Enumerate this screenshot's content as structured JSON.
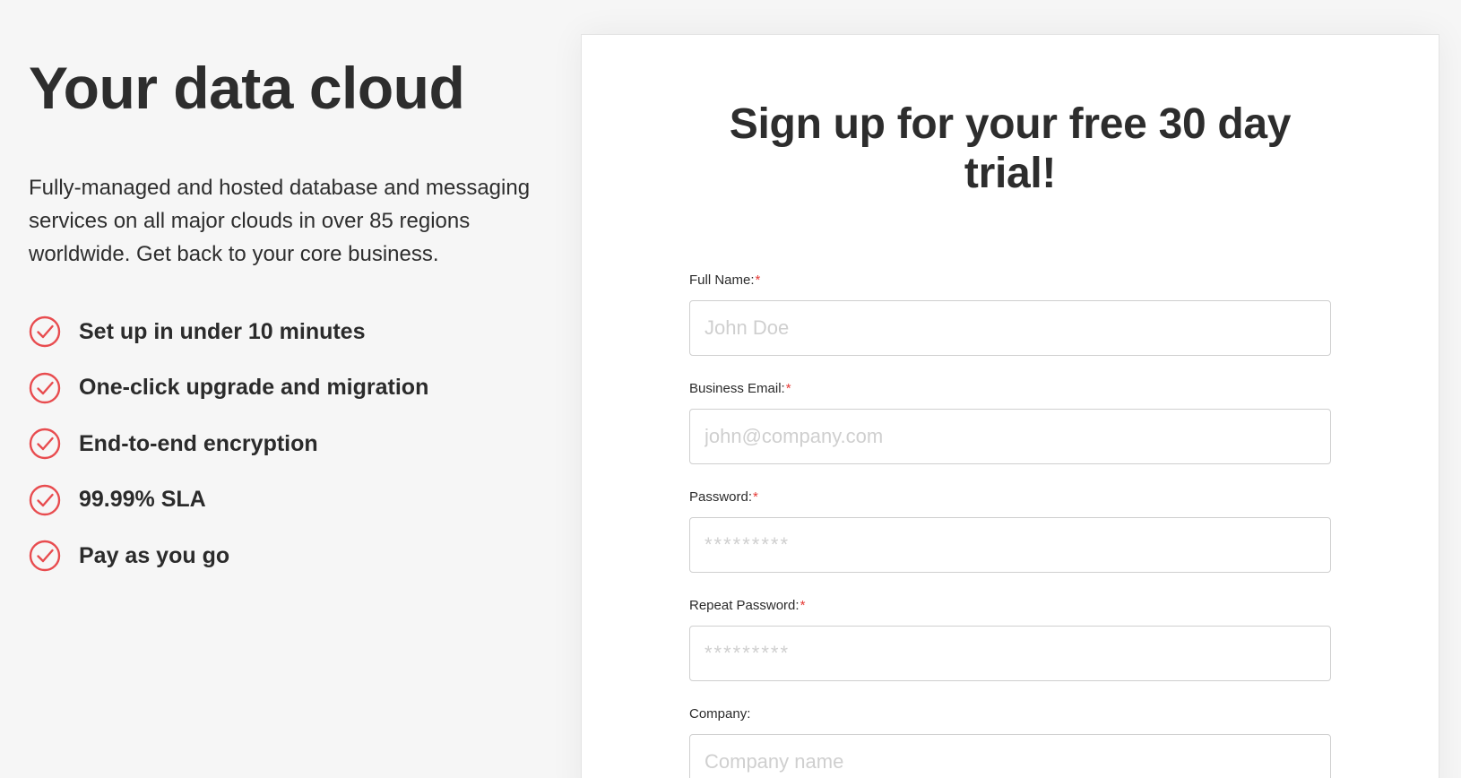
{
  "hero": {
    "title": "Your data cloud",
    "description": "Fully-managed and hosted database and messaging services on all major clouds in over 85 regions worldwide. Get back to your core business.",
    "features": [
      "Set up in under 10 minutes",
      "One-click upgrade and migration",
      "End-to-end encryption",
      "99.99% SLA",
      "Pay as you go"
    ],
    "feature_icon": "check-circle-icon",
    "accent_color": "#e84c4f"
  },
  "signup": {
    "title": "Sign up for your free 30 day trial!",
    "required_marker": "*",
    "fields": {
      "full_name": {
        "label": "Full Name:",
        "placeholder": "John Doe",
        "required": true
      },
      "email": {
        "label": "Business Email:",
        "placeholder": "john@company.com",
        "required": true
      },
      "password": {
        "label": "Password:",
        "placeholder": "*********",
        "required": true
      },
      "repeat_password": {
        "label": "Repeat Password:",
        "placeholder": "*********",
        "required": true
      },
      "company": {
        "label": "Company:",
        "placeholder": "Company name",
        "required": false
      }
    }
  }
}
